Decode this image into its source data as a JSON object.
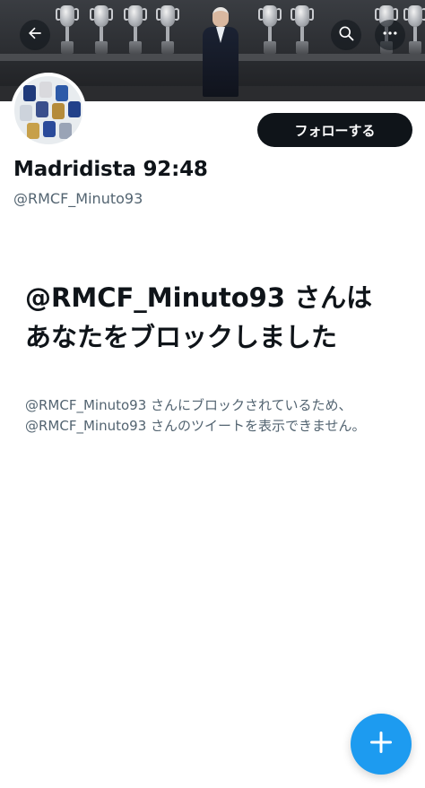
{
  "profile": {
    "display_name": "Madridista 92:48",
    "handle": "@RMCF_Minuto93",
    "follow_label": "フォローする"
  },
  "blocked": {
    "title": "@RMCF_Minuto93 さんはあなたをブロックしました",
    "description": "@RMCF_Minuto93 さんにブロックされているため、@RMCF_Minuto93 さんのツイートを表示できません。"
  },
  "icons": {
    "back": "back-arrow-icon",
    "search": "search-icon",
    "more": "more-icon",
    "compose": "plus-icon"
  },
  "colors": {
    "accent": "#1d9bf0",
    "text_primary": "#0f1419",
    "text_secondary": "#536471"
  }
}
